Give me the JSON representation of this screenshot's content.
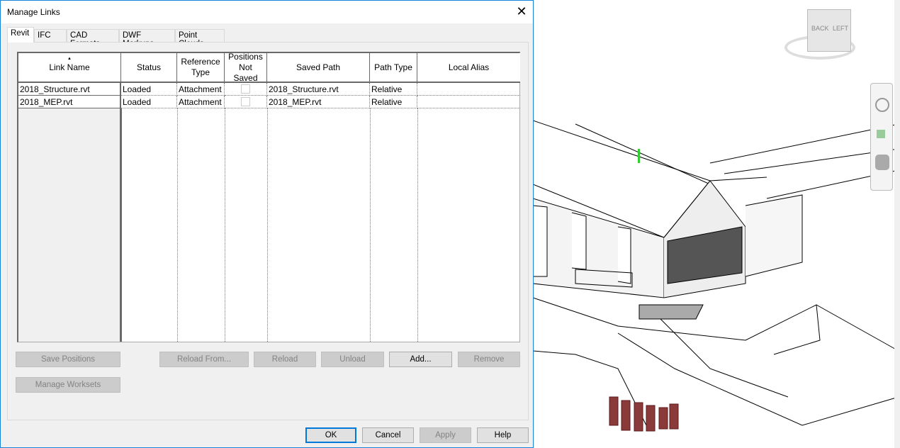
{
  "dialog": {
    "title": "Manage Links",
    "close": "✕"
  },
  "tabs": [
    {
      "label": "Revit",
      "active": true
    },
    {
      "label": "IFC"
    },
    {
      "label": "CAD Formats"
    },
    {
      "label": "DWF Markups"
    },
    {
      "label": "Point Clouds"
    }
  ],
  "grid": {
    "sort_indicator": "▲",
    "columns": [
      "Link Name",
      "Status",
      "Reference Type",
      "Positions Not Saved",
      "Saved Path",
      "Path Type",
      "Local Alias"
    ],
    "rows": [
      {
        "name": "2018_Structure.rvt",
        "status": "Loaded",
        "ref_type": "Attachment",
        "positions_not_saved": false,
        "saved_path": "2018_Structure.rvt",
        "path_type": "Relative",
        "local_alias": ""
      },
      {
        "name": "2018_MEP.rvt",
        "status": "Loaded",
        "ref_type": "Attachment",
        "positions_not_saved": false,
        "saved_path": "2018_MEP.rvt",
        "path_type": "Relative",
        "local_alias": ""
      }
    ]
  },
  "buttons": {
    "save_positions": "Save Positions",
    "manage_worksets": "Manage Worksets",
    "reload_from": "Reload From...",
    "reload": "Reload",
    "unload": "Unload",
    "add": "Add...",
    "remove": "Remove",
    "ok": "OK",
    "cancel": "Cancel",
    "apply": "Apply",
    "help": "Help"
  },
  "viewcube": {
    "back": "BACK",
    "left": "LEFT"
  }
}
